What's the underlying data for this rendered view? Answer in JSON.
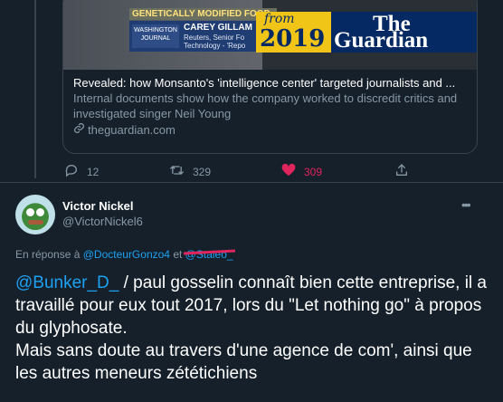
{
  "card": {
    "media": {
      "banner": "GENETICALLY MODIFIED FOOD",
      "logo_top": "WASHINGTON",
      "logo_bottom": "JOURNAL",
      "anchor_name": "CAREY GILLAM",
      "anchor_desc_1": "Reuters, Senior Fo",
      "anchor_desc_2": "Technology - 'Repo",
      "from_word": "from",
      "from_year": "2019",
      "guardian_the": "The",
      "guardian_name": "Guardian"
    },
    "title": "Revealed: how Monsanto's 'intelligence center' targeted journalists and ...",
    "description": "Internal documents show how the company worked to discredit critics and investigated singer Neil Young",
    "domain": "theguardian.com"
  },
  "actions": {
    "replies": "12",
    "retweets": "329",
    "likes": "309"
  },
  "tweet": {
    "author_name": "Victor Nickel",
    "author_handle": "@VictorNickel6",
    "reply_prefix": "En réponse à",
    "reply_to_1": "@DocteurGonzo4",
    "reply_connector": "et",
    "reply_to_2": "@Staleo_",
    "mention": "@Bunker_D_",
    "text_after_mention": " / paul gosselin connaît bien cette entreprise, il a travaillé pour eux tout 2017, lors du \"Let nothing go\" à propos du glyphosate.",
    "text_second_paragraph": "Mais sans doute au travers d'une agence de com', ainsi que les autres meneurs zététichiens"
  },
  "colors": {
    "background": "#15202b",
    "accent": "#1da1f2",
    "like": "#e0245e",
    "muted": "#8899a6"
  },
  "icons": {
    "link": "link-icon",
    "reply": "reply-icon",
    "retweet": "retweet-icon",
    "like": "heart-icon",
    "share": "share-icon",
    "more": "more-icon"
  }
}
